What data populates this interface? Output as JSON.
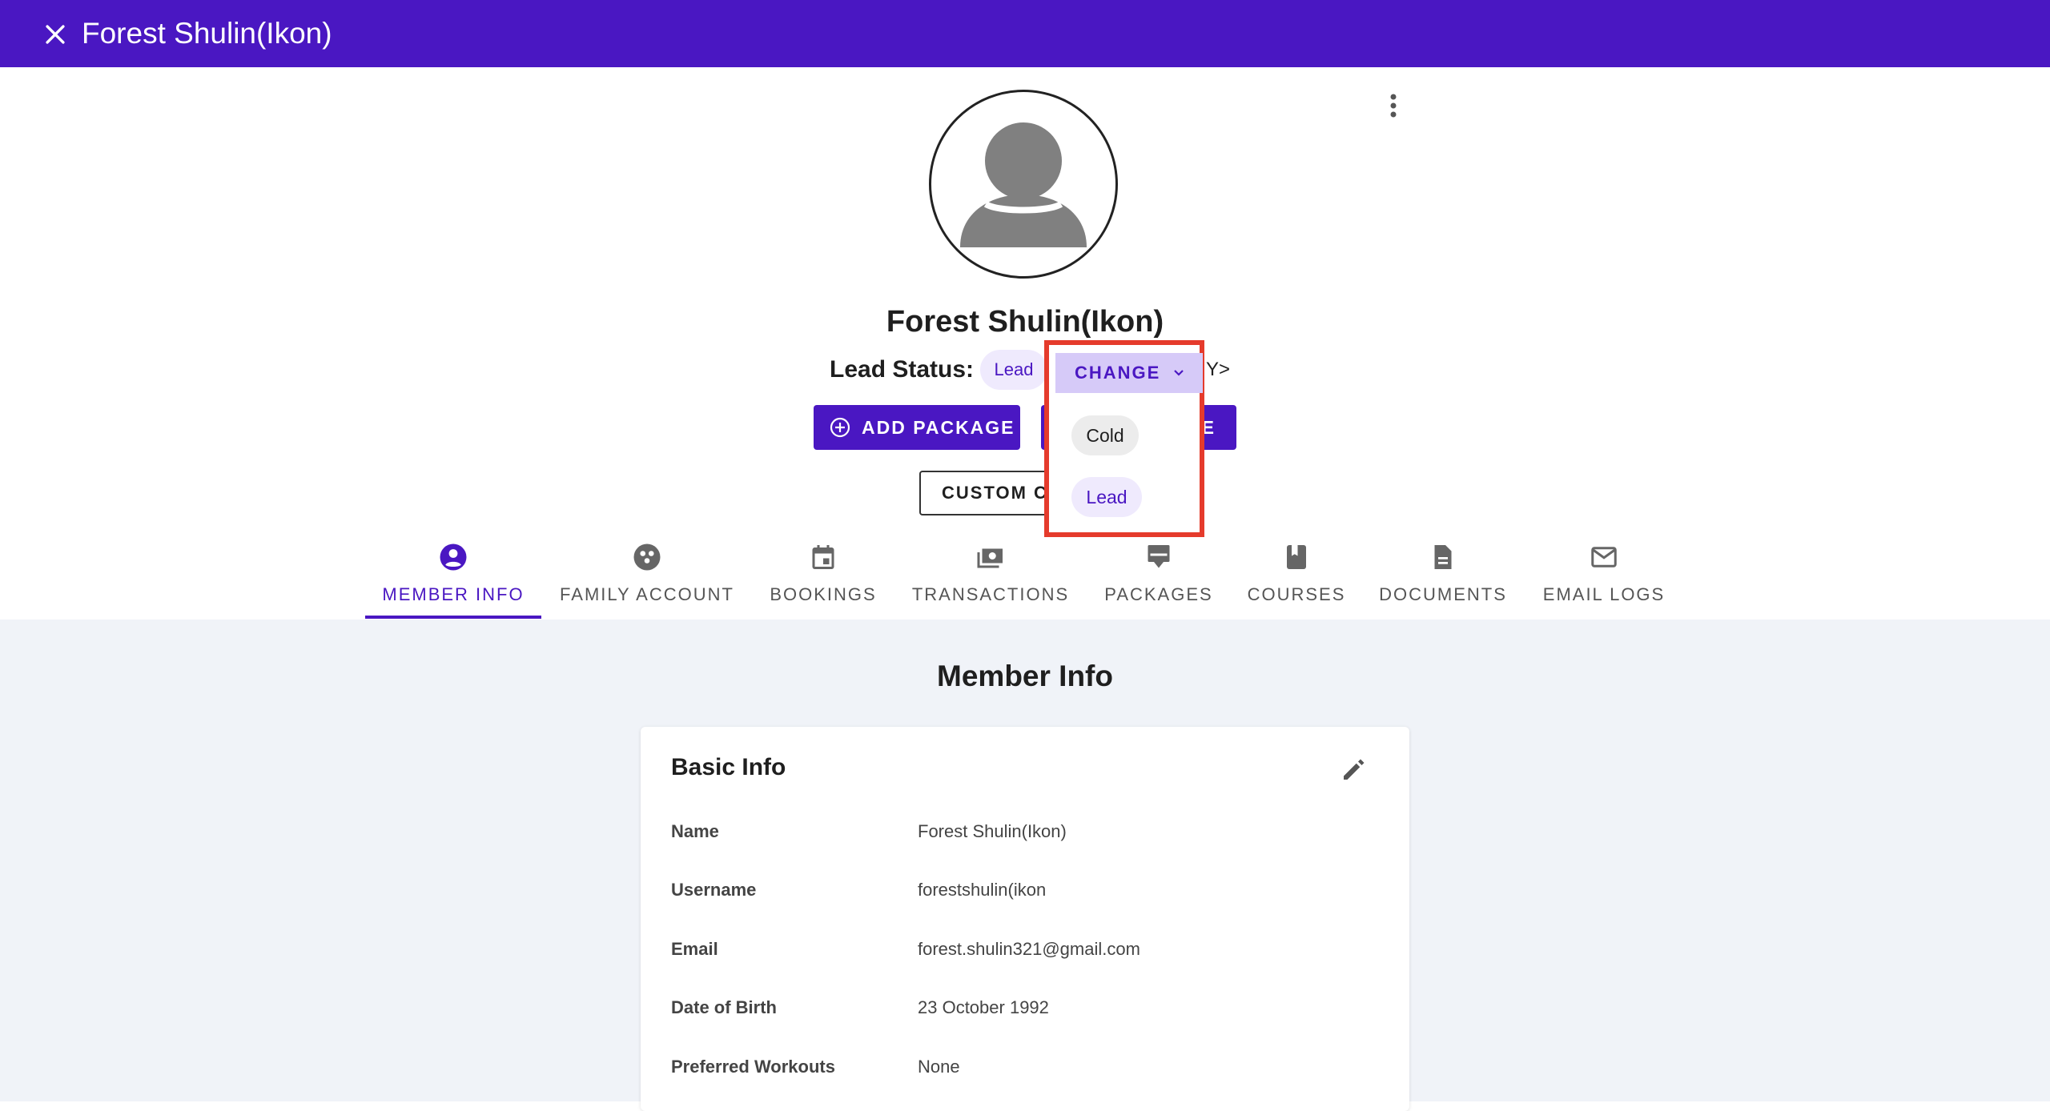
{
  "header": {
    "title": "Forest Shulin(Ikon)",
    "close_icon": "close-icon"
  },
  "profile": {
    "name": "Forest Shulin(Ikon)",
    "lead_status_label": "Lead Status:",
    "lead_status_value": "Lead",
    "partial_suffix": "Y>"
  },
  "actions": {
    "add_package": "ADD PACKAGE",
    "second_button_visible_text": "E",
    "custom_button_visible_text": "CUSTOM C"
  },
  "dropdown": {
    "change_label": "CHANGE",
    "options": [
      {
        "label": "Cold"
      },
      {
        "label": "Lead",
        "selected": true
      }
    ]
  },
  "tabs": [
    {
      "label": "MEMBER INFO",
      "icon": "account-circle-icon",
      "active": true
    },
    {
      "label": "FAMILY ACCOUNT",
      "icon": "family-icon"
    },
    {
      "label": "BOOKINGS",
      "icon": "calendar-icon"
    },
    {
      "label": "TRANSACTIONS",
      "icon": "money-icon"
    },
    {
      "label": "PACKAGES",
      "icon": "package-icon"
    },
    {
      "label": "COURSES",
      "icon": "book-icon"
    },
    {
      "label": "DOCUMENTS",
      "icon": "document-icon"
    },
    {
      "label": "EMAIL LOGS",
      "icon": "mail-icon"
    }
  ],
  "member_info": {
    "section_title": "Member Info",
    "card_title": "Basic Info",
    "fields": [
      {
        "label": "Name",
        "value": "Forest Shulin(Ikon)"
      },
      {
        "label": "Username",
        "value": "forestshulin(ikon"
      },
      {
        "label": "Email",
        "value": "forest.shulin321@gmail.com"
      },
      {
        "label": "Date of Birth",
        "value": "23 October 1992"
      },
      {
        "label": "Preferred Workouts",
        "value": "None"
      }
    ]
  },
  "colors": {
    "brand": "#4a17c2",
    "highlight_border": "#e53b2c",
    "content_bg": "#f0f3f8"
  }
}
